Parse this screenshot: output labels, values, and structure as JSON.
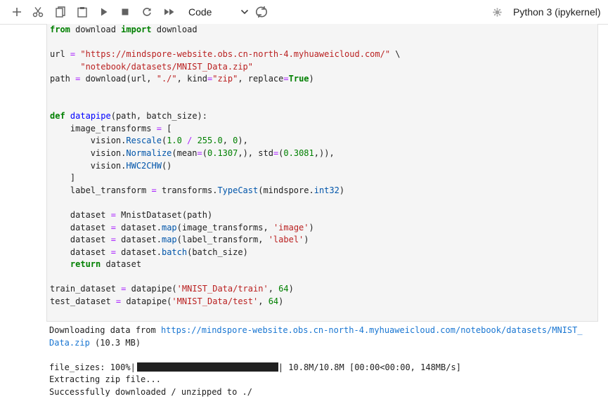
{
  "toolbar": {
    "buttons": [
      {
        "name": "add-cell-button",
        "icon": "plus-icon"
      },
      {
        "name": "cut-button",
        "icon": "scissors-icon"
      },
      {
        "name": "copy-button",
        "icon": "copy-icon"
      },
      {
        "name": "paste-button",
        "icon": "clipboard-icon"
      },
      {
        "name": "run-button",
        "icon": "play-icon"
      },
      {
        "name": "interrupt-button",
        "icon": "stop-icon"
      },
      {
        "name": "restart-button",
        "icon": "refresh-icon"
      },
      {
        "name": "restart-run-all-button",
        "icon": "fast-forward-icon"
      }
    ],
    "cell_type": "Code",
    "kernel_name": "Python 3 (ipykernel)",
    "kernel_status_icon": "gear-icon"
  },
  "code": {
    "lines": [
      [
        [
          "kw",
          "from"
        ],
        [
          "t",
          " download "
        ],
        [
          "kw",
          "import"
        ],
        [
          "t",
          " download"
        ]
      ],
      [],
      [
        [
          "t",
          "url "
        ],
        [
          "op",
          "="
        ],
        [
          "t",
          " "
        ],
        [
          "str",
          "\"https://mindspore-website.obs.cn-north-4.myhuaweicloud.com/\""
        ],
        [
          "t",
          " \\"
        ]
      ],
      [
        [
          "t",
          "      "
        ],
        [
          "str",
          "\"notebook/datasets/MNIST_Data.zip\""
        ]
      ],
      [
        [
          "t",
          "path "
        ],
        [
          "op",
          "="
        ],
        [
          "t",
          " download(url, "
        ],
        [
          "str",
          "\"./\""
        ],
        [
          "t",
          ", kind"
        ],
        [
          "op",
          "="
        ],
        [
          "str",
          "\"zip\""
        ],
        [
          "t",
          ", replace"
        ],
        [
          "op",
          "="
        ],
        [
          "kw",
          "True"
        ],
        [
          "t",
          ")"
        ]
      ],
      [],
      [],
      [
        [
          "kw",
          "def"
        ],
        [
          "t",
          " "
        ],
        [
          "fn",
          "datapipe"
        ],
        [
          "t",
          "(path, batch_size):"
        ]
      ],
      [
        [
          "t",
          "    image_transforms "
        ],
        [
          "op",
          "="
        ],
        [
          "t",
          " ["
        ]
      ],
      [
        [
          "t",
          "        vision."
        ],
        [
          "attr",
          "Rescale"
        ],
        [
          "t",
          "("
        ],
        [
          "num",
          "1.0"
        ],
        [
          "t",
          " "
        ],
        [
          "op",
          "/"
        ],
        [
          "t",
          " "
        ],
        [
          "num",
          "255.0"
        ],
        [
          "t",
          ", "
        ],
        [
          "num",
          "0"
        ],
        [
          "t",
          "),"
        ]
      ],
      [
        [
          "t",
          "        vision."
        ],
        [
          "attr",
          "Normalize"
        ],
        [
          "t",
          "(mean"
        ],
        [
          "op",
          "="
        ],
        [
          "t",
          "("
        ],
        [
          "num",
          "0.1307"
        ],
        [
          "t",
          ",), std"
        ],
        [
          "op",
          "="
        ],
        [
          "t",
          "("
        ],
        [
          "num",
          "0.3081"
        ],
        [
          "t",
          ",)),"
        ]
      ],
      [
        [
          "t",
          "        vision."
        ],
        [
          "attr",
          "HWC2CHW"
        ],
        [
          "t",
          "()"
        ]
      ],
      [
        [
          "t",
          "    ]"
        ]
      ],
      [
        [
          "t",
          "    label_transform "
        ],
        [
          "op",
          "="
        ],
        [
          "t",
          " transforms."
        ],
        [
          "attr",
          "TypeCast"
        ],
        [
          "t",
          "(mindspore."
        ],
        [
          "attr",
          "int32"
        ],
        [
          "t",
          ")"
        ]
      ],
      [],
      [
        [
          "t",
          "    dataset "
        ],
        [
          "op",
          "="
        ],
        [
          "t",
          " MnistDataset(path)"
        ]
      ],
      [
        [
          "t",
          "    dataset "
        ],
        [
          "op",
          "="
        ],
        [
          "t",
          " dataset."
        ],
        [
          "attr",
          "map"
        ],
        [
          "t",
          "(image_transforms, "
        ],
        [
          "str",
          "'image'"
        ],
        [
          "t",
          ")"
        ]
      ],
      [
        [
          "t",
          "    dataset "
        ],
        [
          "op",
          "="
        ],
        [
          "t",
          " dataset."
        ],
        [
          "attr",
          "map"
        ],
        [
          "t",
          "(label_transform, "
        ],
        [
          "str",
          "'label'"
        ],
        [
          "t",
          ")"
        ]
      ],
      [
        [
          "t",
          "    dataset "
        ],
        [
          "op",
          "="
        ],
        [
          "t",
          " dataset."
        ],
        [
          "attr",
          "batch"
        ],
        [
          "t",
          "(batch_size)"
        ]
      ],
      [
        [
          "t",
          "    "
        ],
        [
          "kw",
          "return"
        ],
        [
          "t",
          " dataset"
        ]
      ],
      [],
      [
        [
          "t",
          "train_dataset "
        ],
        [
          "op",
          "="
        ],
        [
          "t",
          " datapipe("
        ],
        [
          "str",
          "'MNIST_Data/train'"
        ],
        [
          "t",
          ", "
        ],
        [
          "num",
          "64"
        ],
        [
          "t",
          ")"
        ]
      ],
      [
        [
          "t",
          "test_dataset "
        ],
        [
          "op",
          "="
        ],
        [
          "t",
          " datapipe("
        ],
        [
          "str",
          "'MNIST_Data/test'"
        ],
        [
          "t",
          ", "
        ],
        [
          "num",
          "64"
        ],
        [
          "t",
          ")"
        ]
      ]
    ]
  },
  "output": {
    "download_prefix": "Downloading data from ",
    "download_url_line1": "https://mindspore-website.obs.cn-north-4.myhuaweicloud.com/notebook/datasets/MNIST_",
    "download_url_line2": "Data.zip",
    "download_size": " (10.3 MB)",
    "progress_label": "file_sizes: 100%|",
    "progress_fraction": 1.0,
    "progress_stats": "| 10.8M/10.8M [00:00<00:00, 148MB/s]",
    "extract_msg": "Extracting zip file...",
    "success_msg": "Successfully downloaded / unzipped to ./"
  }
}
